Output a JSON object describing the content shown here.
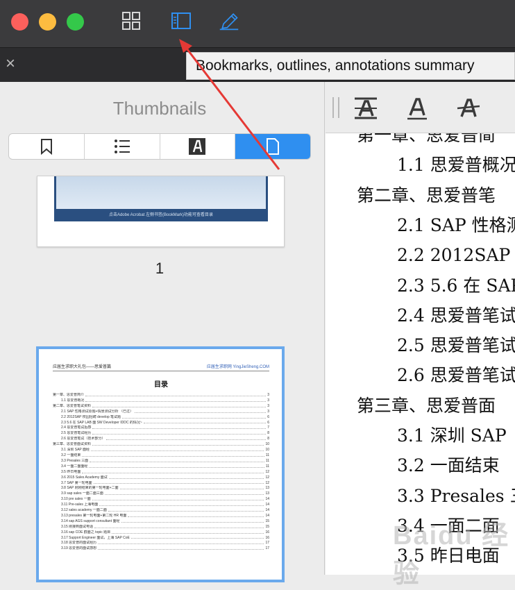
{
  "toolbar": {
    "buttons": [
      "grid-icon",
      "sidebar-icon",
      "highlight-pen-icon"
    ],
    "tooltip": "Bookmarks, outlines, annotations summary"
  },
  "sidebar": {
    "title": "Thumbnails",
    "segments": [
      "bookmark-icon",
      "outline-list-icon",
      "annotation-icon",
      "page-icon"
    ],
    "active_segment": "page-icon",
    "thumbnail_caption": "点击Adobe Acrobat 左侧书签(BookMark)功能可查看目录",
    "page_number": "1",
    "page2": {
      "header_left": "应届生求职大礼包——思爱普篇",
      "header_right": "应届生求职网 YingJieSheng.COM",
      "title": "目录",
      "lines": [
        {
          "label": "第一章、思爱普简介",
          "page": "3",
          "sub": false
        },
        {
          "label": "1.1 思爱普概况",
          "page": "3",
          "sub": true
        },
        {
          "label": "第二章、思爱普笔试资料",
          "page": "3",
          "sub": false
        },
        {
          "label": "2.1 SAP 性格测试原题+情景测试分析 （已过）",
          "page": "3",
          "sub": true
        },
        {
          "label": "2.2 2012SAP 校园招聘 develop 笔试题",
          "page": "6",
          "sub": true
        },
        {
          "label": "2.3 5.6 在 SAP LAB 面 SW Developer IDDC 的情况~",
          "page": "6",
          "sub": true
        },
        {
          "label": "2.4 思爱普笔试后感",
          "page": "7",
          "sub": true
        },
        {
          "label": "2.5 思爱普笔试经历",
          "page": "8",
          "sub": true
        },
        {
          "label": "2.6 思爱普笔试（技术部分）",
          "page": "8",
          "sub": true
        },
        {
          "label": "第三章、思爱普面试资料",
          "page": "10",
          "sub": false
        },
        {
          "label": "3.1 深圳 SAP 面经",
          "page": "10",
          "sub": true
        },
        {
          "label": "3.2 一面结束",
          "page": "11",
          "sub": true
        },
        {
          "label": "3.3 Presales 三面",
          "page": "11",
          "sub": true
        },
        {
          "label": "3.4 一面二面面经",
          "page": "11",
          "sub": true
        },
        {
          "label": "3.5 昨日电面",
          "page": "12",
          "sub": true
        },
        {
          "label": "3.6 2015 Sales Academy 面试",
          "page": "12",
          "sub": true
        },
        {
          "label": "3.7 SAP 第一轮电面",
          "page": "12",
          "sub": true
        },
        {
          "label": "3.8 SAP 刚刚结束的第一轮电面+二面",
          "page": "13",
          "sub": true
        },
        {
          "label": "3.9 sap sales 一面二面三面",
          "page": "13",
          "sub": true
        },
        {
          "label": "3.10 pre sales 一面",
          "page": "14",
          "sub": true
        },
        {
          "label": "3.11 Pre-sales 上海电面",
          "page": "14",
          "sub": true
        },
        {
          "label": "3.12 sales academy 一面二面",
          "page": "14",
          "sub": true
        },
        {
          "label": "3.13 presales 第一轮电面+第二轮 HR 电面",
          "page": "14",
          "sub": true
        },
        {
          "label": "3.14 sap AGS support consultant 面经",
          "page": "15",
          "sub": true
        },
        {
          "label": "3.15 刚接到面试电话",
          "page": "15",
          "sub": true
        },
        {
          "label": "3.16 sap COE 群面之 topic 题目",
          "page": "16",
          "sub": true
        },
        {
          "label": "3.17 Support Engineer 面试，上海 SAP CoE",
          "page": "16",
          "sub": true
        },
        {
          "label": "3.18 思爱普的面试经历",
          "page": "17",
          "sub": true
        },
        {
          "label": "3.19 思爱普的面试感想",
          "page": "17",
          "sub": true
        }
      ]
    }
  },
  "main": {
    "tools": [
      "strikethrough-text-tool-icon",
      "underline-text-tool-icon",
      "strike-text-tool-icon"
    ],
    "toc": [
      {
        "text": "第一章、思爱普简",
        "indent": false
      },
      {
        "text": "1.1 思爱普概况",
        "indent": true
      },
      {
        "text": "第二章、思爱普笔",
        "indent": false
      },
      {
        "text": "2.1 SAP 性格测",
        "indent": true
      },
      {
        "text": "2.2 2012SAP 校",
        "indent": true
      },
      {
        "text": "2.3 5.6 在 SAP",
        "indent": true
      },
      {
        "text": "2.4 思爱普笔试",
        "indent": true
      },
      {
        "text": "2.5 思爱普笔试",
        "indent": true
      },
      {
        "text": "2.6 思爱普笔试",
        "indent": true
      },
      {
        "text": "第三章、思爱普面",
        "indent": false
      },
      {
        "text": "3.1  深圳 SAP",
        "indent": true
      },
      {
        "text": "3.2  一面结束",
        "indent": true
      },
      {
        "text": "3.3 Presales 三",
        "indent": true
      },
      {
        "text": "3.4  一面二面",
        "indent": true
      },
      {
        "text": "3.5  昨日电面",
        "indent": true
      }
    ]
  },
  "watermark": "Baidu 经验",
  "colors": {
    "accent": "#2f8ff0",
    "annotation_arrow": "#e53935"
  }
}
